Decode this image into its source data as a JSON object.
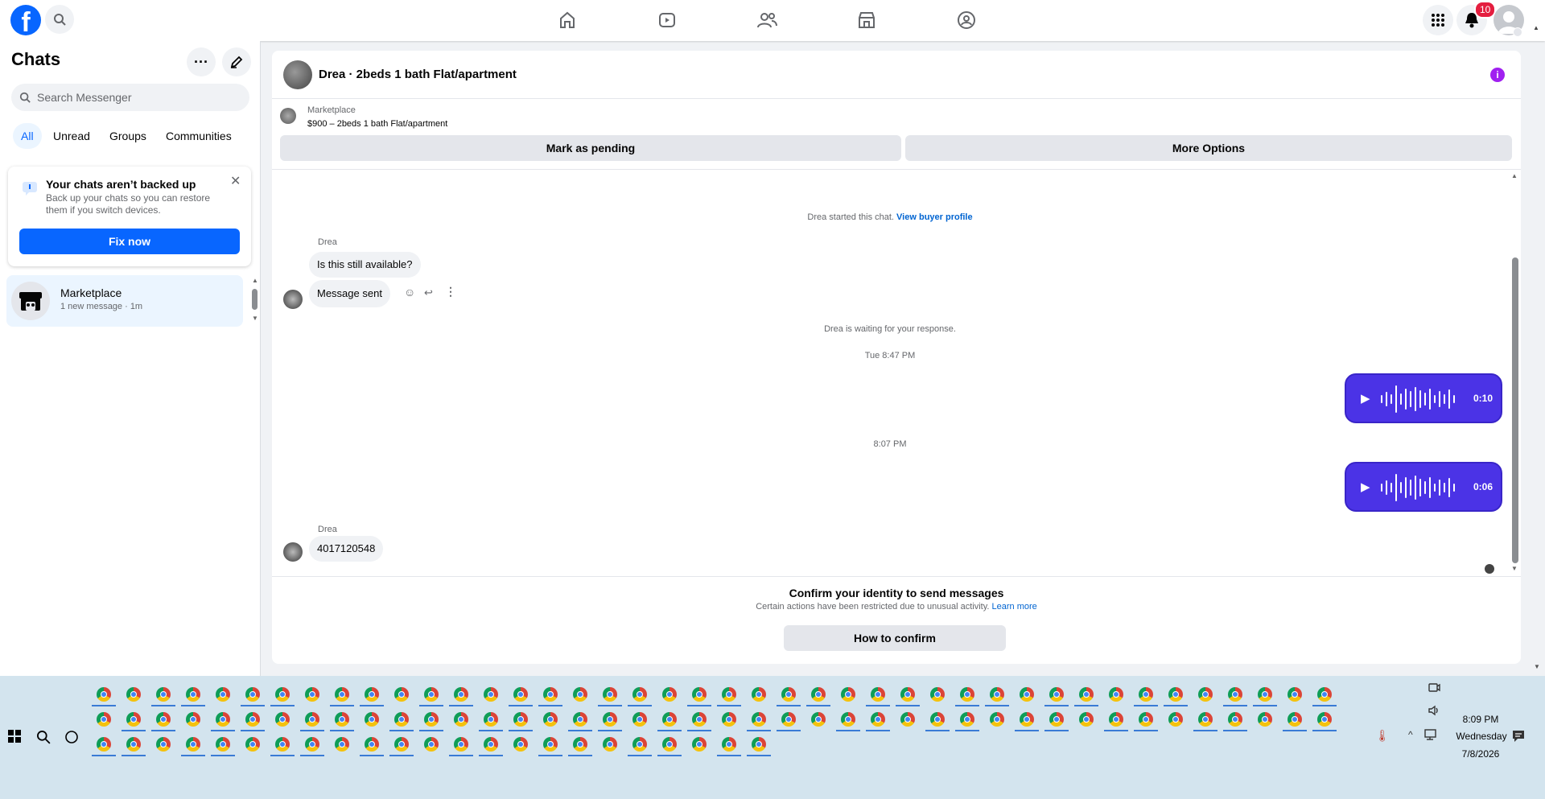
{
  "topbar": {
    "notifications_count": "10"
  },
  "sidebar": {
    "title": "Chats",
    "search_placeholder": "Search Messenger",
    "filters": [
      "All",
      "Unread",
      "Groups",
      "Communities"
    ],
    "backup": {
      "title": "Your chats aren’t backed up",
      "body": "Back up your chats so you can restore them if you switch devices.",
      "button": "Fix now"
    },
    "chat_item": {
      "name": "Marketplace",
      "preview": "1 new message · 1m"
    }
  },
  "conversation": {
    "title": "Drea · 2beds 1 bath Flat/apartment",
    "listing": {
      "source": "Marketplace",
      "title": "$900 – 2beds 1 bath Flat/apartment"
    },
    "buttons": {
      "pending": "Mark as pending",
      "more": "More Options"
    },
    "started_text": "Drea started this chat.",
    "view_profile": "View buyer profile",
    "sender": "Drea",
    "msg1": "Is this still available?",
    "msg2": "Message sent",
    "waiting": "Drea is waiting for your response.",
    "ts1": "Tue 8:47 PM",
    "voice1_duration": "0:10",
    "ts2": "8:07 PM",
    "voice2_duration": "0:06",
    "sender2": "Drea",
    "msg3": "4017120548",
    "confirm_title": "Confirm your identity to send messages",
    "confirm_body": "Certain actions have been restricted due to unusual activity.",
    "learn_more": "Learn more",
    "confirm_button": "How to confirm"
  },
  "taskbar": {
    "time": "8:09 PM",
    "day": "Wednesday",
    "date": "7/8/2026"
  },
  "colors": {
    "accent": "#0866ff",
    "voice_bubble": "#4b33e6",
    "badge": "#e41e3f",
    "info_icon": "#a020f0"
  }
}
